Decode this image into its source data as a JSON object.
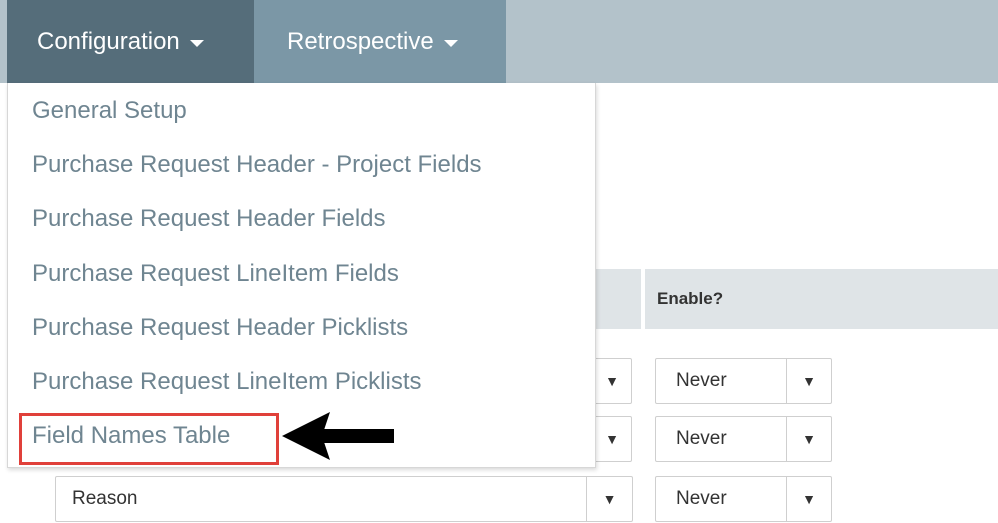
{
  "navbar": {
    "configuration_label": "Configuration",
    "retrospective_label": "Retrospective"
  },
  "dropdown": {
    "items": [
      "General Setup",
      "Purchase Request Header - Project Fields",
      "Purchase Request Header Fields",
      "Purchase Request LineItem Fields",
      "Purchase Request Header Picklists",
      "Purchase Request LineItem Picklists",
      "Field Names Table"
    ],
    "highlighted_item": "Field Names Table"
  },
  "table": {
    "enable_header": "Enable?",
    "rows": [
      {
        "field_value": "",
        "enable_value": "Never"
      },
      {
        "field_value": "",
        "enable_value": "Never"
      },
      {
        "field_value": "Reason",
        "enable_value": "Never"
      }
    ]
  },
  "icons": {
    "dropdown_caret": "caret-down-icon",
    "select_arrow": "triangle-down-icon",
    "annotation": "left-arrow-icon"
  },
  "colors": {
    "nav_active": "#556d7a",
    "nav_secondary": "#7b97a6",
    "nav_bar": "#b3c2ca",
    "menu_text": "#6f8591",
    "highlight_border": "#e0403a"
  }
}
